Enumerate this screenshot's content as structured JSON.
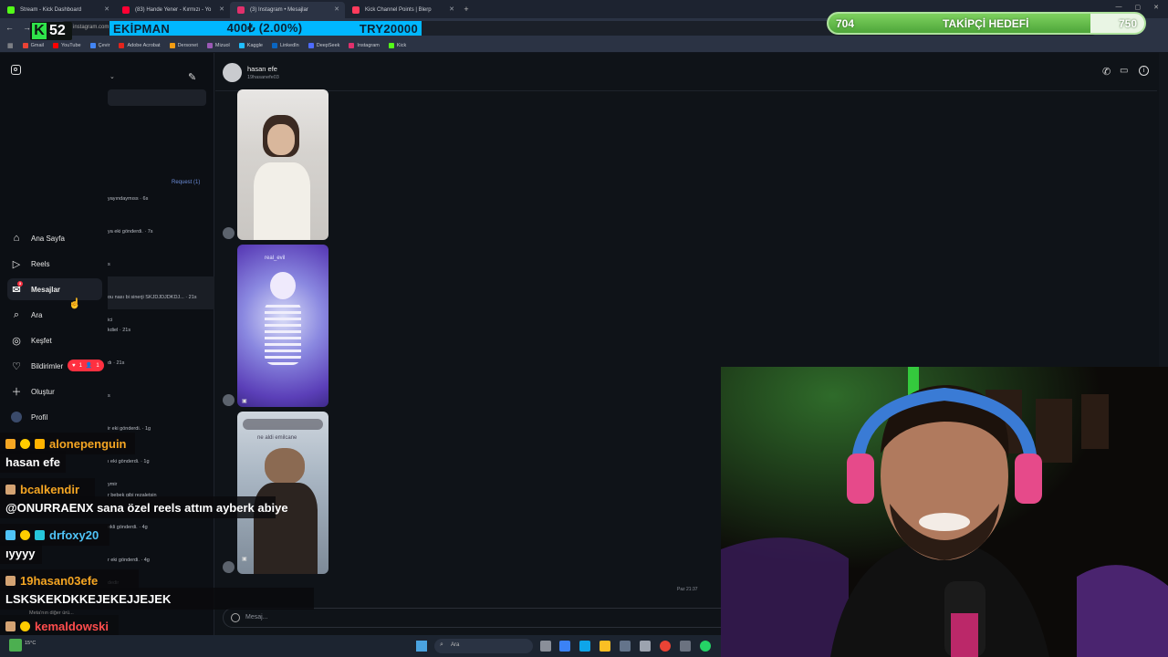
{
  "browser": {
    "tabs": [
      {
        "label": "Stream - Kick Dashboard",
        "color": "#53fc18"
      },
      {
        "label": "(83) Hande Yener - Kırmızı - Yo",
        "color": "#ff0033"
      },
      {
        "label": "(3) Instagram • Mesajlar",
        "color": "#e1306c"
      },
      {
        "label": "Kick Channel Points | Blerp",
        "color": "#ff3b5c"
      }
    ],
    "url": "instagram.com",
    "bookmarks": [
      "Gmail",
      "YouTube",
      "Çevir",
      "Adobe Acrobat",
      "Dersonet",
      "Mizuol",
      "Kaggle",
      "LinkedIn",
      "DeepSeek",
      "Instagram",
      "Kick"
    ]
  },
  "overlay": {
    "kick_number": "52",
    "ekipman_label": "EKİPMAN",
    "ekipman_value": "400₺ (2.00%)",
    "ekipman_target": "TRY20000",
    "goal_current": "704",
    "goal_label": "TAKİPÇİ HEDEFİ",
    "goal_target": "750",
    "goal_progress": 0.83
  },
  "instagram": {
    "nav": [
      {
        "label": "Ana Sayfa",
        "icon": "home-icon"
      },
      {
        "label": "Reels",
        "icon": "reels-icon"
      },
      {
        "label": "Mesajlar",
        "icon": "messenger-icon"
      },
      {
        "label": "Ara",
        "icon": "search-icon"
      },
      {
        "label": "Keşfet",
        "icon": "compass-icon"
      },
      {
        "label": "Bildirimler",
        "icon": "heart-icon"
      },
      {
        "label": "Oluştur",
        "icon": "plus-icon"
      },
      {
        "label": "Profil",
        "icon": "profile-icon"
      }
    ],
    "notif_badge_likes": "1",
    "notif_badge_follows": "1",
    "request_label": "Request (1)",
    "conversations": [
      "yayındaymıss · 6s",
      "ya eki gönderdi. · 7s",
      "s",
      "ou nası bi sinerji SKJDJDJDKDJ... · 21s",
      "ici",
      "kdiel · 21s",
      "dı · 21s",
      "s",
      "ir eki gönderdi. · 1g",
      "ı eki gönderdi. · 1g",
      "ymir",
      "r bebek gibi rezaletsin",
      "ekli gönderdi. · 4g",
      "r eki gönderdi. · 4g",
      "dedir",
      "Meta'nın diğer ürü..."
    ],
    "chat_name": "hasan efe",
    "chat_username": "19hasanefe03",
    "media_captions": [
      "real_evil",
      "ne aldi emilcane"
    ],
    "timestamp": "Paz 21:37",
    "message_placeholder": "Mesaj..."
  },
  "chat_overlay": [
    {
      "user": "alonepenguin",
      "user_color": "#f5a623",
      "message": "hasan efe"
    },
    {
      "user": "bcalkendir",
      "user_color": "#f5a623",
      "message": "@ONURRAENX sana özel reels attım ayberk abiye"
    },
    {
      "user": "drfoxy20",
      "user_color": "#4fc3f7",
      "message": "ıyyyy"
    },
    {
      "user": "19hasan03efe",
      "user_color": "#f5a623",
      "message": "LSKSKEKDKKEJEKEJJEJEK"
    },
    {
      "user": "kemaldowski",
      "user_color": "#ff4d4d",
      "message": ""
    }
  ],
  "taskbar": {
    "search_placeholder": "Ara",
    "weather": "15°C"
  }
}
